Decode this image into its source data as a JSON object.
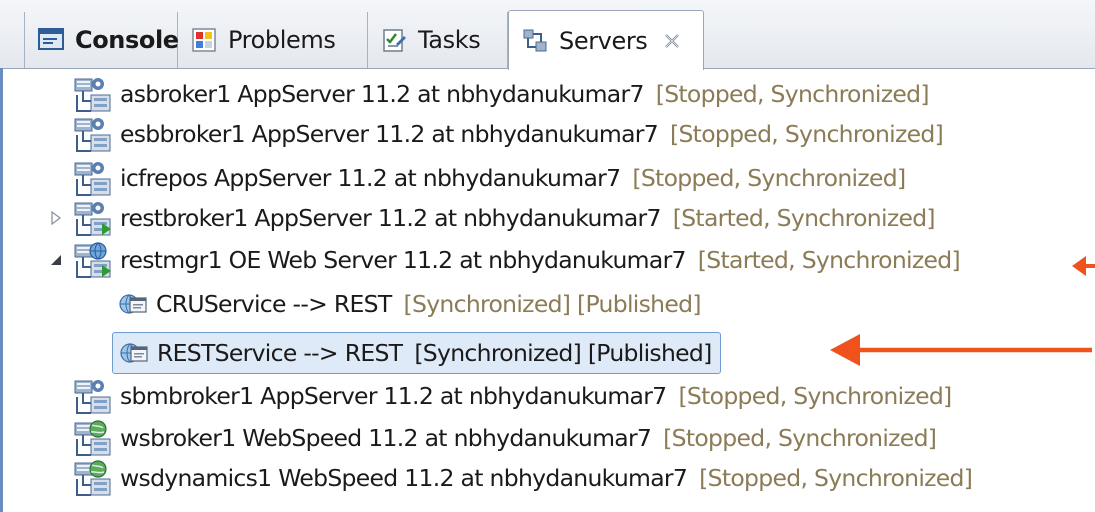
{
  "tabs": [
    {
      "label": "Console",
      "icon": "console-icon",
      "bold": true
    },
    {
      "label": "Problems",
      "icon": "problems-icon"
    },
    {
      "label": "Tasks",
      "icon": "tasks-icon"
    },
    {
      "label": "Servers",
      "icon": "servers-icon",
      "selected": true
    }
  ],
  "servers": [
    {
      "name": "asbroker1 AppServer 11.2 at nbhydanukumar7",
      "status": "[Stopped, Synchronized]",
      "icon": "appserver-icon"
    },
    {
      "name": "esbbroker1 AppServer 11.2 at nbhydanukumar7",
      "status": "[Stopped, Synchronized]",
      "icon": "appserver-icon"
    },
    {
      "name": "icfrepos AppServer 11.2 at nbhydanukumar7",
      "status": "[Stopped, Synchronized]",
      "icon": "appserver-icon"
    },
    {
      "name": "restbroker1 AppServer 11.2 at nbhydanukumar7",
      "status": "[Started, Synchronized]",
      "icon": "appserver-started-icon",
      "toggle": "collapsed"
    },
    {
      "name": "restmgr1 OE Web Server 11.2 at nbhydanukumar7",
      "status": "[Started, Synchronized]",
      "icon": "webserver-icon",
      "toggle": "expanded",
      "children": [
        {
          "name": "CRUService --> REST",
          "status": "[Synchronized] [Published]",
          "icon": "rest-service-icon"
        },
        {
          "name": "RESTService --> REST",
          "status": "[Synchronized] [Published]",
          "icon": "rest-service-icon",
          "selected": true
        }
      ]
    },
    {
      "name": "sbmbroker1 AppServer 11.2 at nbhydanukumar7",
      "status": "[Stopped, Synchronized]",
      "icon": "appserver-icon"
    },
    {
      "name": "wsbroker1 WebSpeed 11.2 at nbhydanukumar7",
      "status": "[Stopped, Synchronized]",
      "icon": "webspeed-icon"
    },
    {
      "name": "wsdynamics1 WebSpeed 11.2 at nbhydanukumar7",
      "status": "[Stopped, Synchronized]",
      "icon": "webspeed-icon"
    }
  ],
  "colors": {
    "status": "#8b7b56",
    "arrow": "#f0521e",
    "selection": "#dfeaf8"
  }
}
